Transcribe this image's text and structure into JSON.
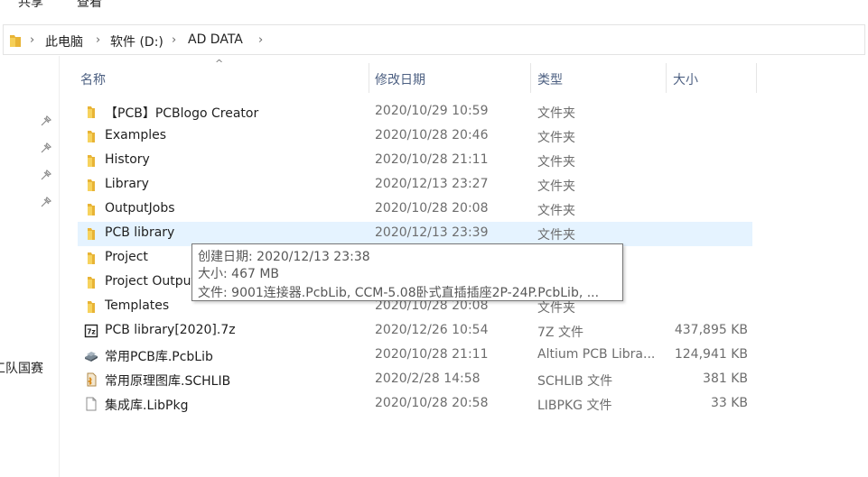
{
  "ribbon": {
    "tabs": [
      "共享",
      "查看"
    ]
  },
  "address_bar": {
    "crumbs": [
      "此电脑",
      "软件 (D:)",
      "AD DATA"
    ]
  },
  "nav_pane": {
    "partial_item": "工队国赛"
  },
  "columns": {
    "name": "名称",
    "date": "修改日期",
    "type": "类型",
    "size": "大小"
  },
  "files": [
    {
      "name": "【PCB】PCBlogo Creator",
      "date": "2020/10/29 10:59",
      "type": "文件夹",
      "size": "",
      "icon": "folder-icon"
    },
    {
      "name": "Examples",
      "date": "2020/10/28 20:46",
      "type": "文件夹",
      "size": "",
      "icon": "folder-icon"
    },
    {
      "name": "History",
      "date": "2020/10/28 21:11",
      "type": "文件夹",
      "size": "",
      "icon": "folder-icon"
    },
    {
      "name": "Library",
      "date": "2020/12/13 23:27",
      "type": "文件夹",
      "size": "",
      "icon": "folder-icon"
    },
    {
      "name": "OutputJobs",
      "date": "2020/10/28 20:08",
      "type": "文件夹",
      "size": "",
      "icon": "folder-icon"
    },
    {
      "name": "PCB library",
      "date": "2020/12/13 23:39",
      "type": "文件夹",
      "size": "",
      "icon": "folder-icon"
    },
    {
      "name": "Project",
      "date": "",
      "type": "",
      "size": "",
      "icon": "folder-icon"
    },
    {
      "name": "Project Outputs",
      "date": "",
      "type": "",
      "size": "",
      "icon": "folder-icon"
    },
    {
      "name": "Templates",
      "date": "2020/10/28 20:08",
      "type": "文件夹",
      "size": "",
      "icon": "folder-icon"
    },
    {
      "name": "PCB library[2020].7z",
      "date": "2020/12/26 10:54",
      "type": "7Z 文件",
      "size": "437,895 KB",
      "icon": "7z-archive-icon"
    },
    {
      "name": "常用PCB库.PcbLib",
      "date": "2020/10/28 21:11",
      "type": "Altium PCB Libra...",
      "size": "124,941 KB",
      "icon": "pcblib-icon"
    },
    {
      "name": "常用原理图库.SCHLIB",
      "date": "2020/2/28 14:58",
      "type": "SCHLIB 文件",
      "size": "381 KB",
      "icon": "schlib-icon"
    },
    {
      "name": "集成库.LibPkg",
      "date": "2020/10/28 20:58",
      "type": "LIBPKG 文件",
      "size": "33 KB",
      "icon": "file-icon"
    }
  ],
  "selected_index": 5,
  "tooltip": {
    "created": "创建日期: 2020/12/13 23:38",
    "size": "大小: 467 MB",
    "files": "文件: 9001连接器.PcbLib, CCM-5.08卧式直插插座2P-24P.PcbLib, ..."
  },
  "colors": {
    "folder": "#e8b436",
    "selection": "#e5f3ff",
    "header_text": "#4d6082"
  }
}
